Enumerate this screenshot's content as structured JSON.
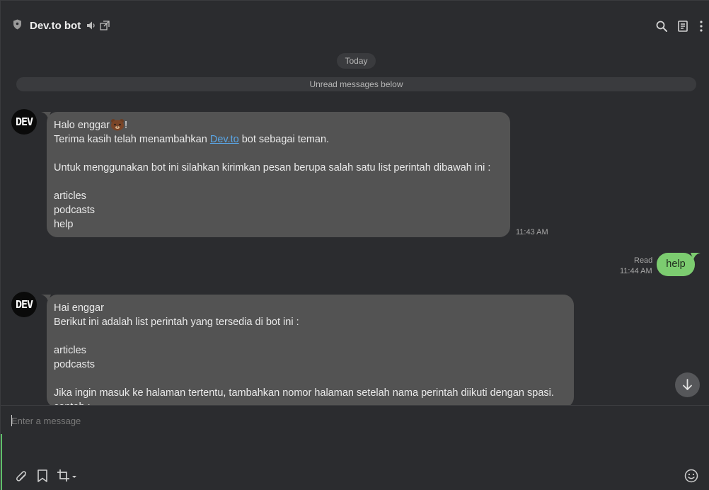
{
  "header": {
    "title": "Dev.to bot",
    "icons": [
      "shield-icon",
      "speaker-icon",
      "popout-icon",
      "search-icon",
      "notes-icon",
      "more-icon"
    ]
  },
  "chat": {
    "date_label": "Today",
    "unread_label": "Unread messages below",
    "avatar_text": "DEV",
    "messages": [
      {
        "sender": "bot",
        "greeting": "Halo enggar",
        "greeting_suffix": "!",
        "line2_before": "Terima kasih telah menambahkan ",
        "link": "Dev.to",
        "line2_after": " bot sebagai teman.",
        "line3": "Untuk menggunakan bot ini silahkan kirimkan pesan berupa salah satu list perintah dibawah ini :",
        "commands": [
          "articles",
          "podcasts",
          "help"
        ],
        "time": "11:43 AM"
      },
      {
        "sender": "me",
        "text": "help",
        "status": "Read",
        "time": "11:44 AM"
      },
      {
        "sender": "bot",
        "lines": [
          "Hai enggar",
          "Berikut ini adalah list perintah yang tersedia di bot ini :",
          "",
          "articles",
          "podcasts",
          "",
          "Jika ingin masuk ke halaman tertentu, tambahkan nomor halaman setelah nama perintah diikuti dengan spasi.",
          "contoh :"
        ]
      }
    ]
  },
  "composer": {
    "placeholder": "Enter a message"
  },
  "colors": {
    "background": "#2b2c2f",
    "bubble_in": "#535353",
    "bubble_out": "#7ccc70",
    "link": "#5aa6e6"
  }
}
